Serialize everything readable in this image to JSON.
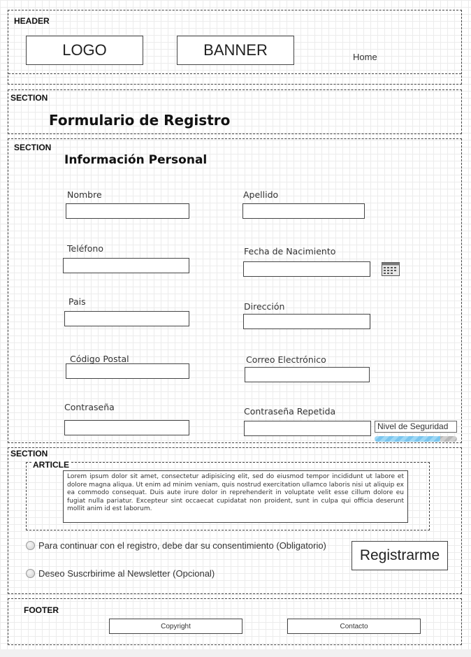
{
  "header": {
    "tag": "HEADER",
    "logo": "LOGO",
    "banner": "BANNER",
    "nav_home": "Home"
  },
  "title_section": {
    "tag": "SECTION",
    "title": "Formulario de Registro"
  },
  "personal_section": {
    "tag": "SECTION",
    "heading": "Información Personal",
    "fields": {
      "nombre": "Nombre",
      "apellido": "Apellido",
      "telefono": "Teléfono",
      "fecha_nacimiento": "Fecha de Nacimiento",
      "pais": "Pais",
      "direccion": "Dirección",
      "codigo_postal": "Código Postal",
      "correo": "Correo Electrónico",
      "contrasena": "Contraseña",
      "contrasena_repetida": "Contraseña Repetida"
    },
    "security_label": "Nivel de Seguridad",
    "security_level": 0.8,
    "calendar_icon": "calendar-icon"
  },
  "consent_section": {
    "tag": "SECTION",
    "article_tag": "ARTICLE",
    "article_text": "Lorem ipsum dolor sit amet, consectetur adipisicing elit, sed do eiusmod tempor incididunt ut labore et dolore magna aliqua. Ut enim ad minim veniam, quis nostrud exercitation ullamco laboris nisi ut aliquip ex ea commodo consequat. Duis aute irure dolor in reprehenderit in voluptate velit esse cillum dolore eu fugiat nulla pariatur. Excepteur sint occaecat cupidatat non proident, sunt in culpa qui officia deserunt mollit anim id est laborum.",
    "consent_option": "Para continuar con el registro, debe dar su consentimiento (Obligatorio)",
    "newsletter_option": "Deseo Suscrbirime al Newsletter (Opcional)",
    "submit_label": "Registrarme"
  },
  "footer": {
    "tag": "FOOTER",
    "copyright": "Copyright",
    "contacto": "Contacto"
  },
  "colors": {
    "progress_fill": "#9fd8f5",
    "progress_track": "#cfcfcf"
  }
}
